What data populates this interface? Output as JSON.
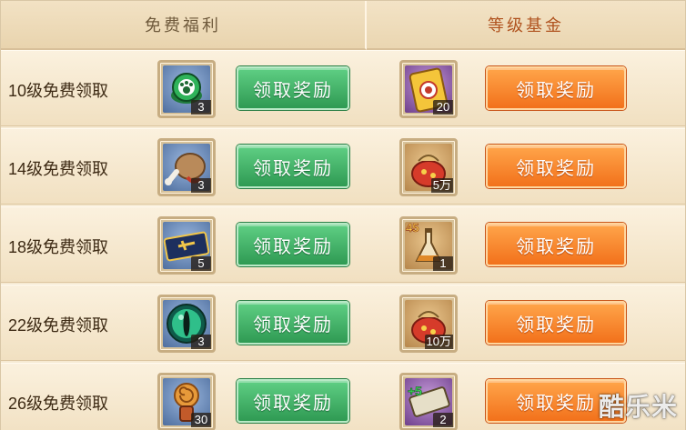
{
  "header": {
    "free_title": "免费福利",
    "fund_title": "等级基金"
  },
  "button_label": "领取奖励",
  "rows": [
    {
      "label": "10级免费领取",
      "free_item": {
        "icon": "green-paw-badge-icon",
        "qty": "3"
      },
      "fund_item": {
        "icon": "gold-card-icon",
        "qty": "20"
      }
    },
    {
      "label": "14级免费领取",
      "free_item": {
        "icon": "meat-sack-icon",
        "qty": "3"
      },
      "fund_item": {
        "icon": "money-bag-icon",
        "qty": "5万"
      }
    },
    {
      "label": "18级免费领取",
      "free_item": {
        "icon": "blue-scroll-ticket-icon",
        "qty": "5"
      },
      "fund_item": {
        "icon": "level-45-flask-icon",
        "qty": "1"
      }
    },
    {
      "label": "22级免费领取",
      "free_item": {
        "icon": "green-eye-orb-icon",
        "qty": "3"
      },
      "fund_item": {
        "icon": "money-bag-icon",
        "qty": "10万"
      }
    },
    {
      "label": "26级免费领取",
      "free_item": {
        "icon": "spiral-scroll-icon",
        "qty": "30"
      },
      "fund_item": {
        "icon": "plus-5-scroll-icon",
        "qty": "2"
      }
    }
  ],
  "watermark": "酷乐米",
  "colors": {
    "background": "#f6ead3",
    "green_button": "#3fae63",
    "orange_button": "#f6842a",
    "fund_title": "#b0531f"
  }
}
